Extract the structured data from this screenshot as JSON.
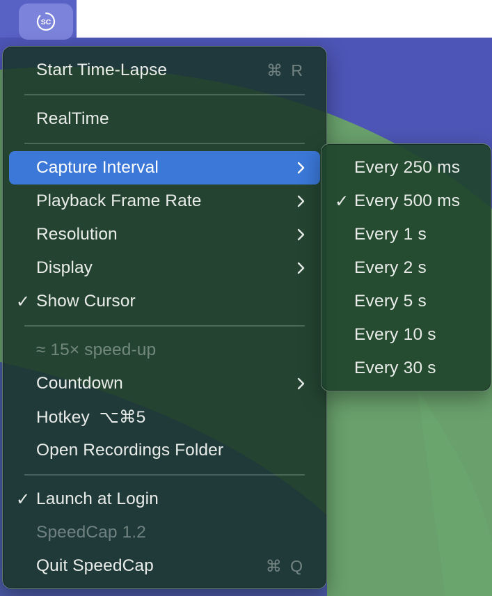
{
  "menubar": {
    "status_icon_text": "SC",
    "status_icon": "speedcap-logo-icon"
  },
  "colors": {
    "menu_background": "#1a3427",
    "highlight": "#3b78d8",
    "wallpaper_blue": "#4f56b4",
    "wallpaper_green": "#6aa26e"
  },
  "main_menu": {
    "start_time_lapse": {
      "label": "Start Time-Lapse",
      "shortcut": "⌘ R"
    },
    "realtime": {
      "label": "RealTime"
    },
    "capture_interval": {
      "label": "Capture Interval"
    },
    "playback_frame_rate": {
      "label": "Playback Frame Rate"
    },
    "resolution": {
      "label": "Resolution"
    },
    "display": {
      "label": "Display"
    },
    "show_cursor": {
      "label": "Show Cursor",
      "checked": true,
      "check": "✓"
    },
    "speedup": {
      "label": "≈ 15× speed-up"
    },
    "countdown": {
      "label": "Countdown"
    },
    "hotkey": {
      "label": "Hotkey  ⌥⌘5"
    },
    "open_folder": {
      "label": "Open Recordings Folder"
    },
    "launch_at_login": {
      "label": "Launch at Login",
      "checked": true,
      "check": "✓"
    },
    "version": {
      "label": "SpeedCap 1.2"
    },
    "quit": {
      "label": "Quit SpeedCap",
      "shortcut": "⌘ Q"
    }
  },
  "capture_interval_submenu": {
    "selected": "Every 500 ms",
    "check": "✓",
    "options": [
      "Every 250 ms",
      "Every 500 ms",
      "Every 1 s",
      "Every 2 s",
      "Every 5 s",
      "Every 10 s",
      "Every 30 s"
    ]
  }
}
